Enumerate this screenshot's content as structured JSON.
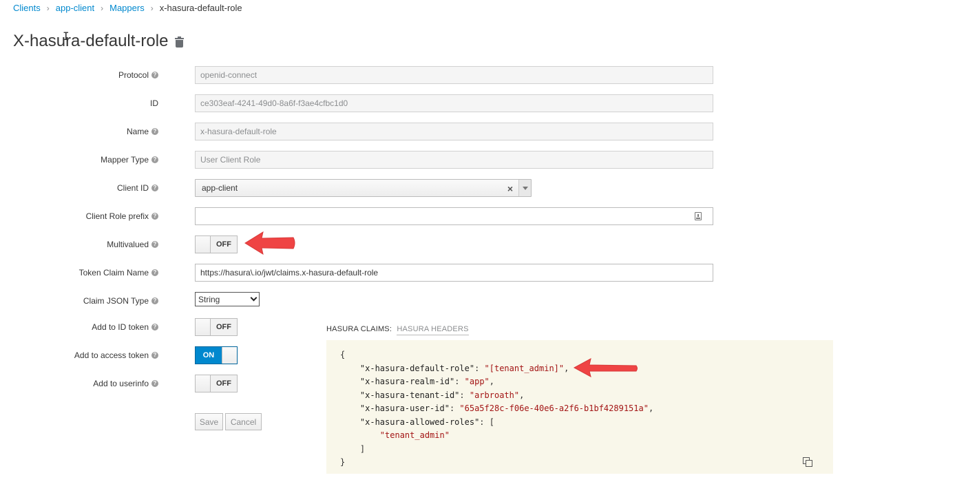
{
  "breadcrumb": {
    "items": [
      "Clients",
      "app-client",
      "Mappers"
    ],
    "current": "x-hasura-default-role",
    "separator": "›"
  },
  "page": {
    "title": "X-hasura-default-role"
  },
  "form": {
    "protocol": {
      "label": "Protocol",
      "value": "openid-connect"
    },
    "id": {
      "label": "ID",
      "value": "ce303eaf-4241-49d0-8a6f-f3ae4cfbc1d0"
    },
    "name": {
      "label": "Name",
      "value": "x-hasura-default-role"
    },
    "mapper_type": {
      "label": "Mapper Type",
      "value": "User Client Role"
    },
    "client_id": {
      "label": "Client ID",
      "value": "app-client",
      "clear": "×"
    },
    "client_role_prefix": {
      "label": "Client Role prefix",
      "value": ""
    },
    "multivalued": {
      "label": "Multivalued",
      "state": "OFF"
    },
    "token_claim_name": {
      "label": "Token Claim Name",
      "value": "https://hasura\\.io/jwt/claims.x-hasura-default-role"
    },
    "claim_json_type": {
      "label": "Claim JSON Type",
      "value": "String"
    },
    "add_to_id_token": {
      "label": "Add to ID token",
      "state": "OFF"
    },
    "add_to_access_token": {
      "label": "Add to access token",
      "state": "ON"
    },
    "add_to_userinfo": {
      "label": "Add to userinfo",
      "state": "OFF"
    },
    "help": "?",
    "save": "Save",
    "cancel": "Cancel"
  },
  "claims": {
    "tab_active": "HASURA CLAIMS:",
    "tab_inactive": "HASURA HEADERS",
    "open_brace": "{",
    "lines": [
      {
        "key": "\"x-hasura-default-role\"",
        "value": "\"[tenant_admin]\"",
        "tail": ","
      },
      {
        "key": "\"x-hasura-realm-id\"",
        "value": "\"app\"",
        "tail": ","
      },
      {
        "key": "\"x-hasura-tenant-id\"",
        "value": "\"arbroath\"",
        "tail": ","
      },
      {
        "key": "\"x-hasura-user-id\"",
        "value": "\"65a5f28c-f06e-40e6-a2f6-b1bf4289151a\"",
        "tail": ","
      }
    ],
    "allowed_key": "\"x-hasura-allowed-roles\"",
    "allowed_open": "[",
    "allowed_item": "\"tenant_admin\"",
    "allowed_close": "]",
    "close_brace": "}"
  },
  "colors": {
    "accent": "#0088ce",
    "annotation_arrow": "#ef4444",
    "claims_bg": "#f9f7ea"
  }
}
